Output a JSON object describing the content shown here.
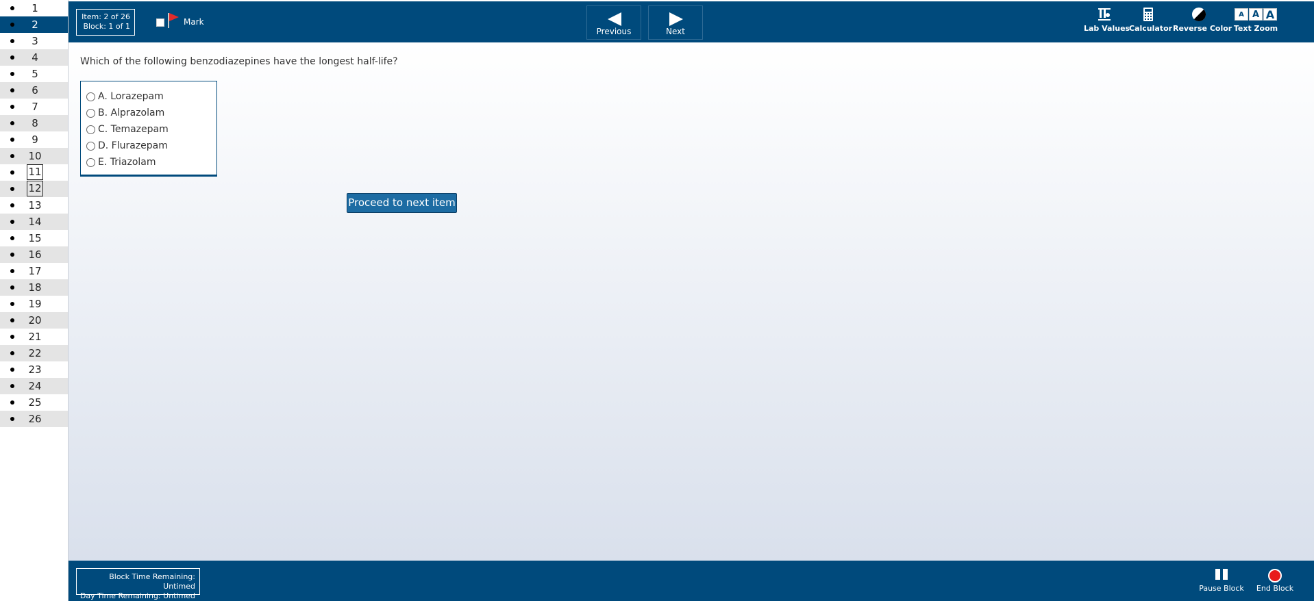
{
  "sidebar": {
    "items": [
      "1",
      "2",
      "3",
      "4",
      "5",
      "6",
      "7",
      "8",
      "9",
      "10",
      "11",
      "12",
      "13",
      "14",
      "15",
      "16",
      "17",
      "18",
      "19",
      "20",
      "21",
      "22",
      "23",
      "24",
      "25",
      "26"
    ],
    "active": "2",
    "boxed": [
      "11",
      "12"
    ]
  },
  "topbar": {
    "item_status": "Item: 2 of 26",
    "block_status": "Block: 1 of 1",
    "mark_label": "Mark",
    "previous_label": "Previous",
    "next_label": "Next",
    "tools": {
      "lab_values": "Lab Values",
      "calculator": "Calculator",
      "reverse_color": "Reverse Color",
      "text_zoom": "Text Zoom",
      "zoom_letter": "A"
    }
  },
  "question": {
    "text": "Which of the following benzodiazepines have the longest half-life?",
    "options": [
      "A. Lorazepam",
      "B. Alprazolam",
      "C. Temazepam",
      "D. Flurazepam",
      "E. Triazolam"
    ],
    "proceed_label": "Proceed to next item"
  },
  "bottombar": {
    "block_time": "Block Time Remaining: Untimed",
    "day_time": "Day Time Remaining: Untimed",
    "pause_label": "Pause Block",
    "end_label": "End Block"
  },
  "colors": {
    "primary": "#004a7c",
    "flag": "#e02b2b",
    "end": "#e81b1b"
  }
}
